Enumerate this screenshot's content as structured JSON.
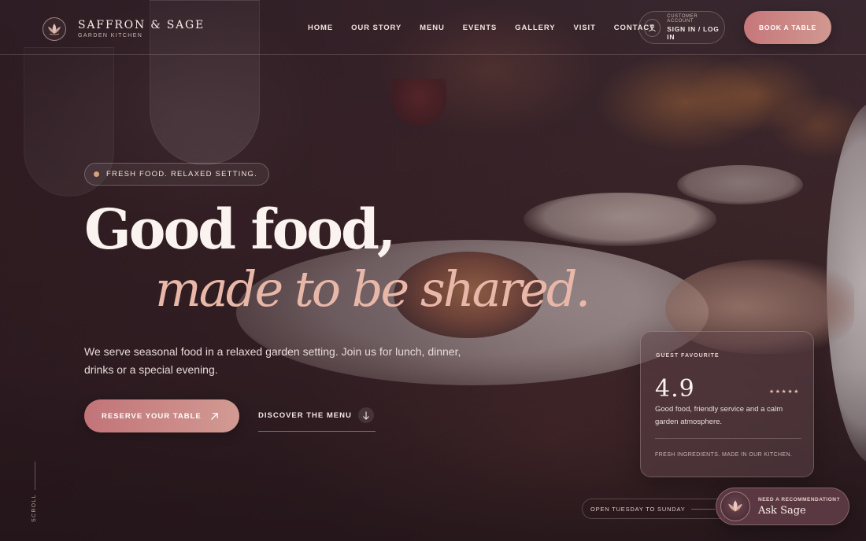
{
  "brand": {
    "name": "SAFFRON & SAGE",
    "subtitle": "GARDEN KITCHEN",
    "logo_icon": "lotus-icon"
  },
  "nav": {
    "items": [
      "HOME",
      "OUR STORY",
      "MENU",
      "EVENTS",
      "GALLERY",
      "VISIT",
      "CONTACT"
    ]
  },
  "account": {
    "small_label": "CUSTOMER ACCOUNT",
    "action_label": "SIGN IN / LOG IN",
    "icon": "user-icon"
  },
  "header_cta": "BOOK A TABLE",
  "hero": {
    "badge": "FRESH FOOD. RELAXED SETTING.",
    "headline_line1": "Good food,",
    "headline_line2": "made to be shared.",
    "description": "We serve seasonal food in a relaxed garden setting. Join us for lunch, dinner, drinks or a special evening.",
    "primary_cta": "RESERVE YOUR TABLE",
    "primary_cta_icon": "arrow-up-right-icon",
    "secondary_cta": "DISCOVER THE MENU",
    "secondary_cta_icon": "arrow-down-icon"
  },
  "rating_card": {
    "eyebrow": "GUEST FAVOURITE",
    "score": "4.9",
    "stars": "★★★★★",
    "text": "Good food, friendly service and a calm garden atmosphere.",
    "footer": "FRESH INGREDIENTS. MADE IN OUR KITCHEN."
  },
  "scroll_label": "SCROLL",
  "hours": "OPEN TUESDAY TO SUNDAY",
  "assistant": {
    "prompt": "NEED A RECOMMENDATION?",
    "label": "Ask Sage",
    "icon": "lotus-icon"
  },
  "colors": {
    "accent": "#c6777a",
    "accent_light": "#e9b7a8",
    "background": "#2e1d22",
    "star": "#e7c1a8"
  }
}
